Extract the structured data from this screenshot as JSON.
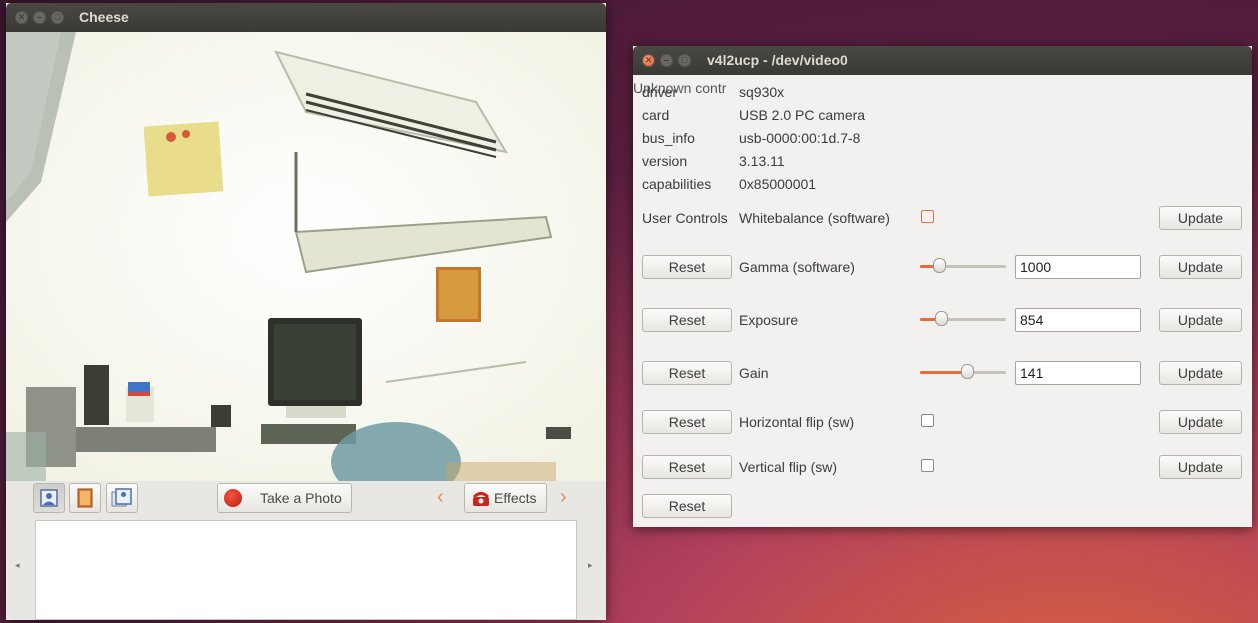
{
  "cheese": {
    "title": "Cheese",
    "take_photo_label": "Take a Photo",
    "effects_label": "Effects",
    "mode_icons": [
      "photo-mode-icon",
      "video-mode-icon",
      "burst-mode-icon"
    ],
    "record_color": "#d8261c"
  },
  "v4l2ucp": {
    "title": "v4l2ucp - /dev/video0",
    "overlap_text": "Unknown contr",
    "info": [
      {
        "label": "driver",
        "value": "sq930x"
      },
      {
        "label": "card",
        "value": "USB 2.0 PC camera"
      },
      {
        "label": "bus_info",
        "value": "usb-0000:00:1d.7-8"
      },
      {
        "label": "version",
        "value": "3.13.11"
      },
      {
        "label": "capabilities",
        "value": "0x85000001"
      }
    ],
    "section_label": "User Controls",
    "controls": [
      {
        "name": "Whitebalance (software)",
        "type": "checkbox",
        "checked": false,
        "update_label": "Update"
      },
      {
        "name": "Gamma (software)",
        "type": "slider",
        "value": "1000",
        "level": 0.22,
        "reset_label": "Reset",
        "update_label": "Update"
      },
      {
        "name": "Exposure",
        "type": "slider",
        "value": "854",
        "level": 0.24,
        "reset_label": "Reset",
        "update_label": "Update"
      },
      {
        "name": "Gain",
        "type": "slider",
        "value": "141",
        "level": 0.55,
        "reset_label": "Reset",
        "update_label": "Update"
      },
      {
        "name": "Horizontal flip (sw)",
        "type": "checkbox",
        "checked": false,
        "reset_label": "Reset",
        "update_label": "Update"
      },
      {
        "name": "Vertical flip (sw)",
        "type": "checkbox",
        "checked": false,
        "reset_label": "Reset",
        "update_label": "Update"
      }
    ],
    "last_reset_label": "Reset"
  }
}
